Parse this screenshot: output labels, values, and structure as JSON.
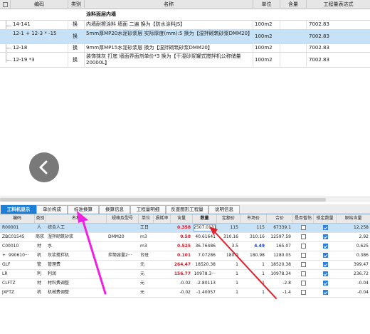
{
  "quota_table": {
    "headers": {
      "code": "编码",
      "category": "类别",
      "name": "名称",
      "unit": "单位",
      "content": "含量",
      "quantity_expr": "工程量表达式"
    },
    "rows": [
      {
        "code": "",
        "category": "",
        "name": "涂料面层内墙",
        "unit": "",
        "content": "",
        "quantity_expr": "",
        "group": true
      },
      {
        "code": "14-141",
        "category": "换",
        "name": "内墙耐擦涂料 墙面 二遍  换为【防水涂料JS】",
        "unit": "100m2",
        "content": "",
        "quantity_expr": "7002.83"
      },
      {
        "code": "12-1 + 12-3 * -15",
        "category": "换",
        "name": "5mm厚MP20水泥砂浆层  实际厚度(mm):5  换为【湿拌砌筑砂浆DMM20】",
        "unit": "100m2",
        "content": "",
        "quantity_expr": "7002.83",
        "selected": true
      },
      {
        "code": "12-18",
        "category": "换",
        "name": "9mm厚MP15水泥砂浆层 换为【湿拌砌筑砂浆DMM20】",
        "unit": "100m2",
        "content": "",
        "quantity_expr": "7002.83"
      },
      {
        "code": "12-19 *3",
        "category": "换",
        "name": "装饰抹灰 打底  墙面界面剂单价*3  换为【干混砂浆罐式搅拌机公称储量20000L】",
        "unit": "100m2",
        "content": "",
        "quantity_expr": "7002.83"
      }
    ]
  },
  "tabs": [
    {
      "label": "工料机显示",
      "active": true
    },
    {
      "label": "单价构成"
    },
    {
      "label": "标准换算"
    },
    {
      "label": "换算信息"
    },
    {
      "label": "工程量明细"
    },
    {
      "label": "反查图形工程量"
    },
    {
      "label": "说明信息"
    }
  ],
  "resource_table": {
    "headers": {
      "code": "编码",
      "category": "类别",
      "name": "名称",
      "spec": "规格及型号",
      "unit": "单位",
      "loss": "损耗率",
      "content": "含量",
      "quantity": "数量",
      "base_price": "定额价",
      "market_price": "市场价",
      "total": "合价",
      "is_provisional": "是否暂估",
      "lock_qty": "锁定数量",
      "original_content": "原始含量"
    },
    "rows": [
      {
        "expand": "",
        "code": "R00001",
        "category": "人",
        "name": "综合人工",
        "spec": "",
        "unit": "工日",
        "loss": "",
        "content": "0.358",
        "quantity": "2507.0131",
        "base_price": "115",
        "market_price": "115",
        "total": "67339.1",
        "provisional": false,
        "lock": true,
        "original_content": "12.258",
        "selected": true,
        "content_red": true
      },
      {
        "expand": "",
        "code": "ZBC01545",
        "category": "商浆",
        "name": "湿拌砌筑砂浆",
        "spec": "DMM20",
        "unit": "m3",
        "loss": "",
        "content": "0.58",
        "quantity": "40.61641",
        "base_price": "310.16",
        "market_price": "310.16",
        "total": "12597.59",
        "provisional": false,
        "lock": true,
        "original_content": "2.92",
        "content_red": true
      },
      {
        "expand": "",
        "code": "C00010",
        "category": "材",
        "name": "水",
        "spec": "",
        "unit": "m3",
        "loss": "",
        "content": "0.525",
        "quantity": "36.76486",
        "base_price": "3.5",
        "market_price": "4.49",
        "total": "165.07",
        "provisional": false,
        "lock": true,
        "original_content": "0.625",
        "content_red": true,
        "market_blue": true
      },
      {
        "expand": "+",
        "code": "990610···",
        "category": "机",
        "name": "灰浆搅拌机",
        "spec": "拌筒容量2···",
        "unit": "台班",
        "loss": "",
        "content": "0.101",
        "quantity": "7.07286",
        "base_price": "180.9",
        "market_price": "180.98",
        "total": "1280.05",
        "provisional": false,
        "lock": true,
        "original_content": "0.386",
        "content_red": true
      },
      {
        "expand": "",
        "code": "GLF",
        "category": "管",
        "name": "管理费",
        "spec": "",
        "unit": "元",
        "loss": "",
        "content": "264.47",
        "quantity": "18520.38",
        "base_price": "1",
        "market_price": "1",
        "total": "18520.38",
        "provisional": false,
        "lock": true,
        "original_content": "399.47",
        "content_red": true
      },
      {
        "expand": "",
        "code": "LR",
        "category": "利",
        "name": "利润",
        "spec": "",
        "unit": "元",
        "loss": "",
        "content": "156.77",
        "quantity": "10978.3···",
        "base_price": "1",
        "market_price": "1",
        "total": "10978.34",
        "provisional": false,
        "lock": true,
        "original_content": "236.72",
        "content_red": true
      },
      {
        "expand": "",
        "code": "CLFTZ",
        "category": "材",
        "name": "材料费调整",
        "spec": "",
        "unit": "元",
        "loss": "",
        "content": "-0.02",
        "quantity": "-2.80113",
        "base_price": "1",
        "market_price": "1",
        "total": "-2.8",
        "provisional": false,
        "lock": true,
        "original_content": "-0.04"
      },
      {
        "expand": "",
        "code": "JXFTZ",
        "category": "机",
        "name": "机械费调整",
        "spec": "",
        "unit": "元",
        "loss": "",
        "content": "-0.02",
        "quantity": "-1.40057",
        "base_price": "1",
        "market_price": "1",
        "total": "-1.4",
        "provisional": false,
        "lock": true,
        "original_content": "-0.04"
      }
    ]
  },
  "icons": {
    "back": "chevron-left-icon",
    "annotation": "magenta-arrow-icon"
  },
  "colors": {
    "selected_row": "#c7e2f7",
    "active_tab": "#1e7fd6",
    "annotation_magenta": "#f020e0",
    "annotation_red": "#e0202a"
  }
}
